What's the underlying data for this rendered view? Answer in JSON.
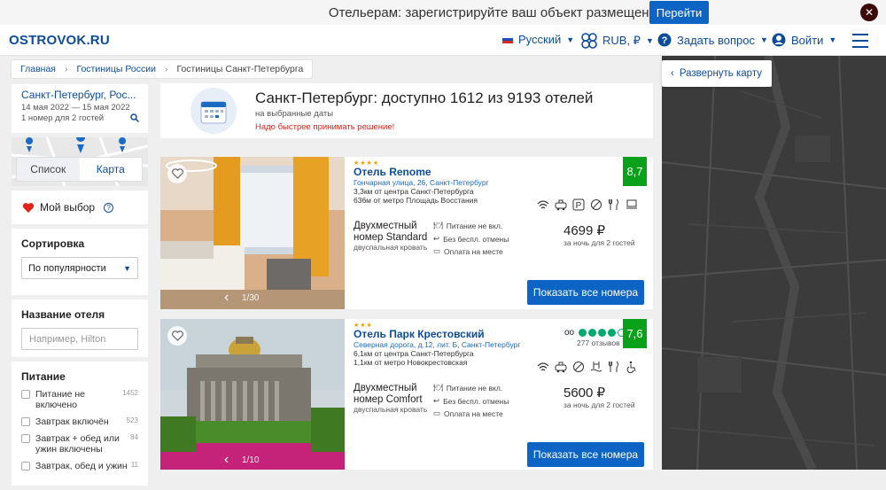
{
  "promo": {
    "text": "Отельерам: зарегистрируйте ваш объект размещения",
    "button": "Перейти",
    "close": "✕"
  },
  "header": {
    "logo": "OSTROVOK.RU",
    "language": "Русский",
    "currency": "RUB, ₽",
    "ask": "Задать вопрос",
    "login": "Войти"
  },
  "breadcrumb": [
    "Главная",
    "Гостиницы России",
    "Гостиницы Санкт-Петербурга"
  ],
  "search": {
    "city": "Санкт-Петербург, Рос...",
    "dates": "14 мая 2022 — 15 мая 2022",
    "guests": "1 номер для 2 гостей"
  },
  "view_toggle": {
    "list": "Список",
    "map": "Карта"
  },
  "favorites": {
    "label": "Мой выбор"
  },
  "sort": {
    "title": "Сортировка",
    "value": "По популярности"
  },
  "name_filter": {
    "title": "Название отеля",
    "placeholder": "Например, Hilton"
  },
  "food": {
    "title": "Питание",
    "items": [
      {
        "label": "Питание не включено",
        "count": "1452"
      },
      {
        "label": "Завтрак включён",
        "count": "523"
      },
      {
        "label": "Завтрак + обед или ужин включены",
        "count": "84"
      },
      {
        "label": "Завтрак, обед и ужин",
        "count": "11"
      }
    ]
  },
  "banner": {
    "title": "Санкт-Петербург: доступно 1612 из 9193 отелей",
    "sub": "на выбранные даты",
    "urgent": "Надо быстрее принимать решение!"
  },
  "hotels": [
    {
      "stars": "★★★★",
      "name": "Отель Renome",
      "address": "Гончарная улица, 26, Санкт-Петербург",
      "dist1": "3,3км от центра Санкт-Петербурга",
      "dist2": "636м от метро Площадь Восстания",
      "score": "8,7",
      "room": "Двухместный номер Standard",
      "bed": "двуспальная кровать",
      "cond1": "Питание не вкл.",
      "cond2": "Без беспл. отмены",
      "cond3": "Оплата на месте",
      "price": "4699 ₽",
      "price_for": "за ночь для 2 гостей",
      "button": "Показать все номера",
      "photos": "1/30"
    },
    {
      "stars": "★★★",
      "name": "Отель Парк Крестовский",
      "address": "Северная дорога, д.12, лит. Б, Санкт-Петербург",
      "dist1": "6,1км от центра Санкт-Петербурга",
      "dist2": "1,1км от метро Новокрестовская",
      "score": "7,6",
      "reviews": "277 отзывов",
      "review_rating": 4,
      "room": "Двухместный номер Comfort",
      "bed": "двуспальная кровать",
      "cond1": "Питание не вкл.",
      "cond2": "Без беспл. отмены",
      "cond3": "Оплата на месте",
      "price": "5600 ₽",
      "price_for": "за ночь для 2 гостей",
      "button": "Показать все номера",
      "photos": "1/10"
    }
  ],
  "map": {
    "expand": "Развернуть карту"
  },
  "colors": {
    "brand": "#0e4c9a",
    "button": "#0d64c5",
    "score": "#09a11a",
    "urgent": "#e0241b"
  }
}
